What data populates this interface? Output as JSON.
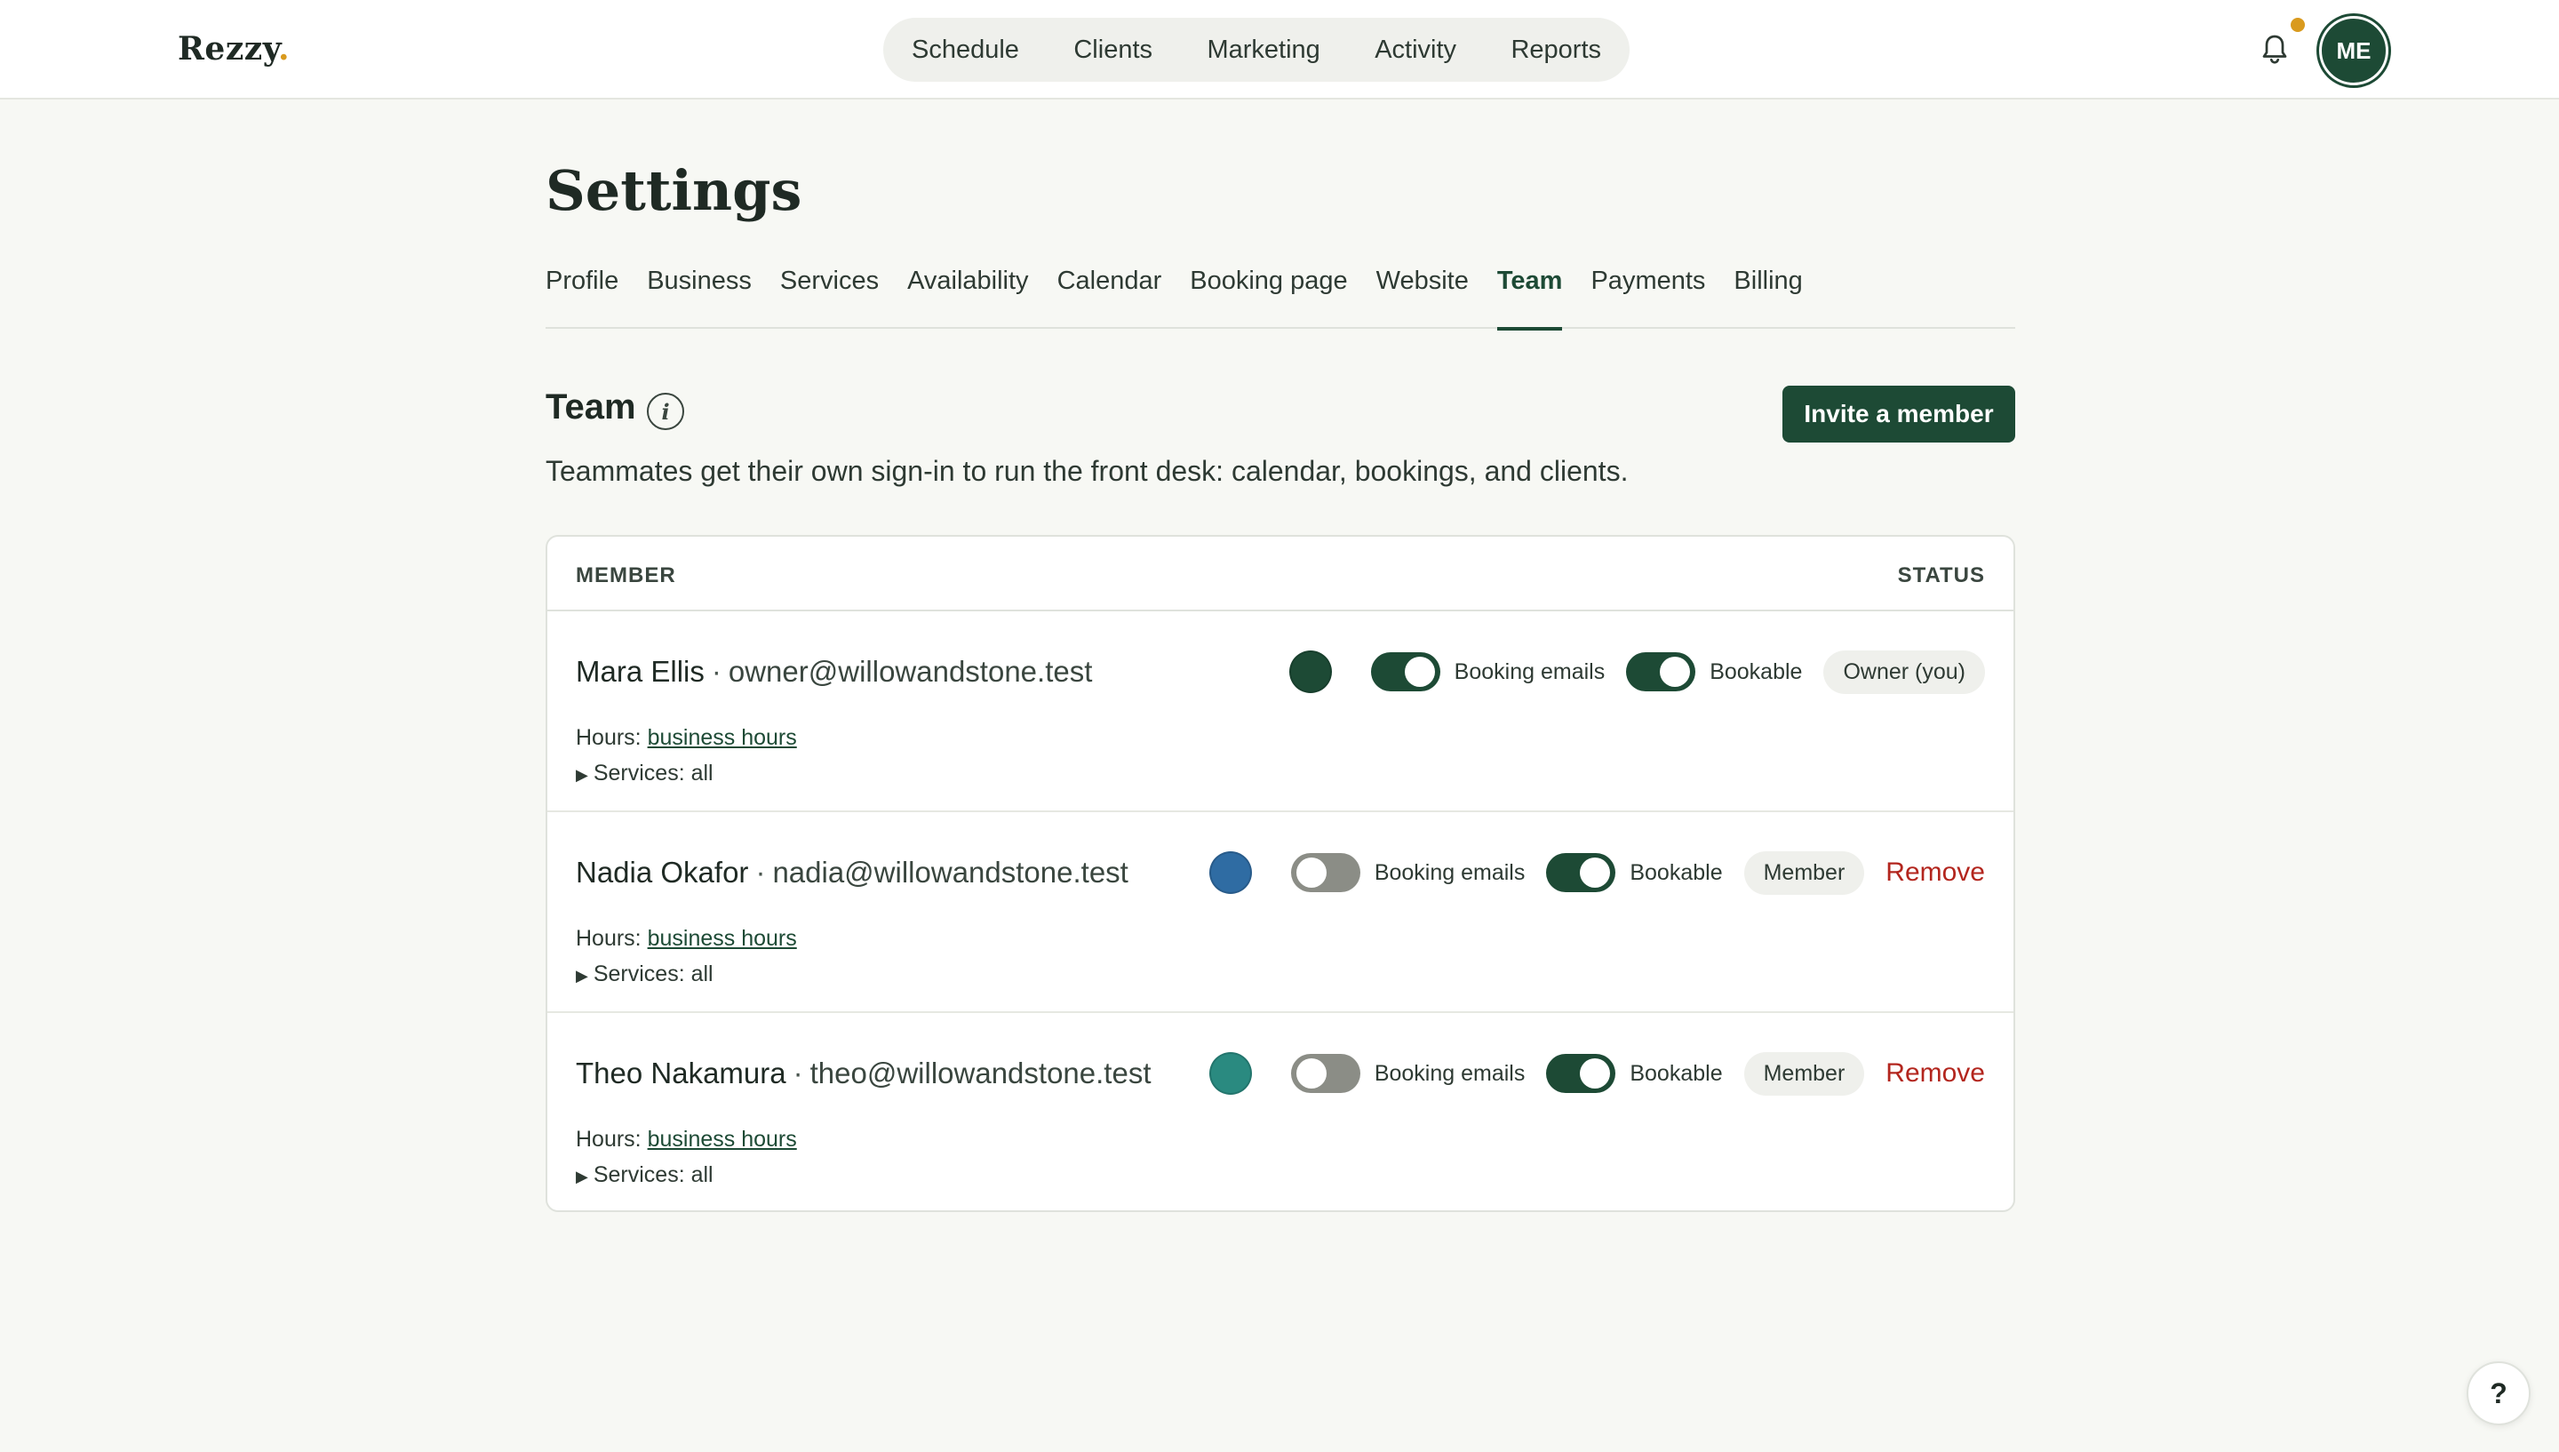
{
  "app": {
    "logo": "Rezzy",
    "logo_dot": ".",
    "nav": [
      "Schedule",
      "Clients",
      "Marketing",
      "Activity",
      "Reports"
    ],
    "avatar_initials": "ME",
    "help_label": "?"
  },
  "settings": {
    "title": "Settings",
    "tabs": [
      "Profile",
      "Business",
      "Services",
      "Availability",
      "Calendar",
      "Booking page",
      "Website",
      "Team",
      "Payments",
      "Billing"
    ],
    "active_tab": "Team"
  },
  "team": {
    "title": "Team",
    "info_icon": "i",
    "invite_label": "Invite a member",
    "description": "Teammates get their own sign-in to run the front desk: calendar, bookings, and clients.",
    "col_member": "MEMBER",
    "col_status": "STATUS",
    "booking_emails_label": "Booking emails",
    "bookable_label": "Bookable",
    "hours_prefix": "Hours:",
    "hours_link": "business hours",
    "services_label": "Services: all",
    "separator": "·",
    "remove_label": "Remove",
    "members": [
      {
        "name": "Mara Ellis",
        "email": "owner@willowandstone.test",
        "color": "#1d4a35",
        "booking_emails": true,
        "bookable": true,
        "role": "Owner (you)",
        "removable": false
      },
      {
        "name": "Nadia Okafor",
        "email": "nadia@willowandstone.test",
        "color": "#2f6ca3",
        "booking_emails": false,
        "bookable": true,
        "role": "Member",
        "removable": true
      },
      {
        "name": "Theo Nakamura",
        "email": "theo@willowandstone.test",
        "color": "#2a8a80",
        "booking_emails": false,
        "bookable": true,
        "role": "Member",
        "removable": true
      }
    ]
  },
  "colors": {
    "brand": "#1d4a35",
    "accent": "#d99a1e",
    "danger": "#b3261e",
    "background": "#f7f8f4"
  }
}
